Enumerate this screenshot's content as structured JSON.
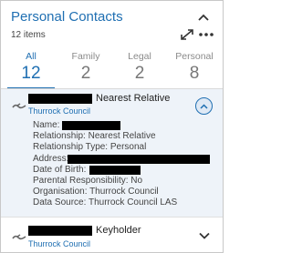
{
  "header": {
    "title": "Personal Contacts",
    "count": "12 items",
    "collapse_icon": "chevron-up-icon",
    "expand_icon": "expand-arrows-icon",
    "more_icon": "more-icon"
  },
  "tabs": [
    {
      "label": "All",
      "count": "12",
      "active": true
    },
    {
      "label": "Family",
      "count": "2",
      "active": false
    },
    {
      "label": "Legal",
      "count": "2",
      "active": false
    },
    {
      "label": "Personal",
      "count": "8",
      "active": false
    }
  ],
  "contacts": [
    {
      "role": "Nearest Relative",
      "org": "Thurrock Council",
      "expanded": true,
      "icon": "handshake-icon",
      "toggle_icon": "chevron-up-icon",
      "details": {
        "name_label": "Name:",
        "relationship": "Relationship: Nearest Relative",
        "relationship_type": "Relationship Type: Personal",
        "address_label": "Address:",
        "dob_label": "Date of Birth:",
        "parental": "Parental Responsibility: No",
        "organisation": "Organisation: Thurrock Council",
        "data_source": "Data Source: Thurrock Council LAS"
      }
    },
    {
      "role": "Keyholder",
      "org": "Thurrock Council",
      "expanded": false,
      "icon": "handshake-icon",
      "toggle_icon": "chevron-down-icon"
    }
  ],
  "colors": {
    "accent": "#1f6fb2",
    "selected_bg": "#eef3f9",
    "redaction": "#000000"
  }
}
